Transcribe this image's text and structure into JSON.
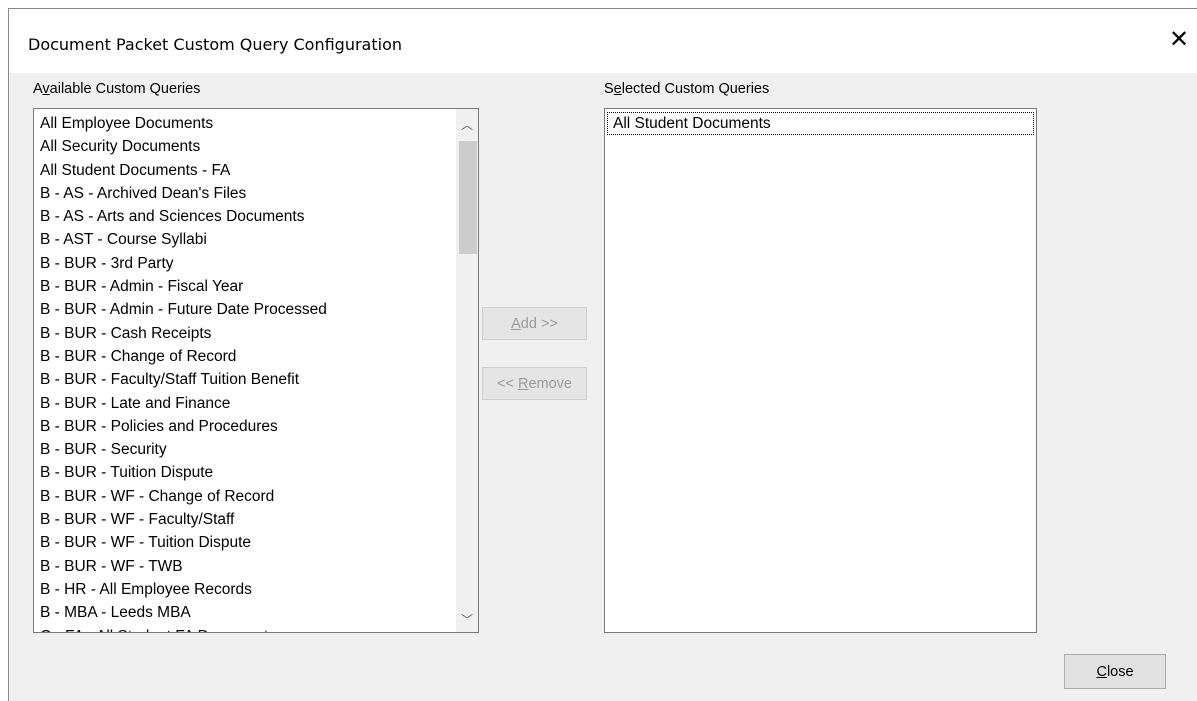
{
  "window": {
    "title": "Document Packet Custom Query Configuration",
    "close_glyph": "✕"
  },
  "available": {
    "label_pre": "A",
    "label_ul": "v",
    "label_post": "ailable Custom Queries",
    "items": [
      "All Employee Documents",
      "All Security Documents",
      "All Student Documents - FA",
      "B - AS - Archived Dean's Files",
      "B - AS - Arts and Sciences Documents",
      "B - AST - Course Syllabi",
      "B - BUR - 3rd Party",
      "B - BUR - Admin - Fiscal Year",
      "B - BUR - Admin - Future Date Processed",
      "B - BUR - Cash Receipts",
      "B - BUR - Change of Record",
      "B - BUR - Faculty/Staff Tuition Benefit",
      "B - BUR - Late and Finance",
      "B - BUR - Policies and Procedures",
      "B - BUR - Security",
      "B - BUR - Tuition Dispute",
      "B - BUR - WF - Change of Record",
      "B - BUR - WF - Faculty/Staff",
      "B - BUR - WF - Tuition Dispute",
      "B - BUR - WF - TWB",
      "B - HR - All Employee Records",
      "B - MBA - Leeds MBA",
      "C - FA - All Student FA Documents"
    ],
    "scroll_up_icon": "chevron-up-icon",
    "scroll_down_icon": "chevron-down-icon"
  },
  "selected": {
    "label_pre": "S",
    "label_ul": "e",
    "label_post": "lected Custom Queries",
    "items": [
      "All Student Documents"
    ]
  },
  "buttons": {
    "add_ul": "A",
    "add_post": "dd >>",
    "remove_pre": "<< ",
    "remove_ul": "R",
    "remove_post": "emove",
    "close_ul": "C",
    "close_post": "lose"
  }
}
